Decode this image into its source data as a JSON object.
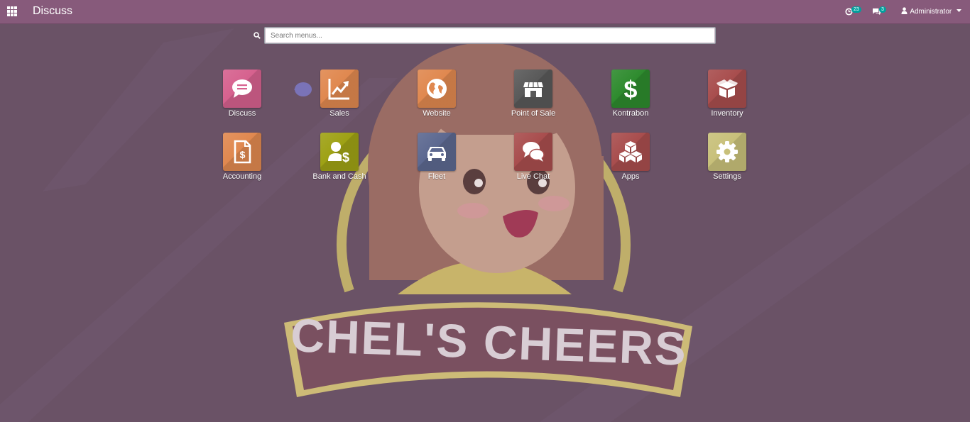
{
  "navbar": {
    "title": "Discuss",
    "activity_count": "23",
    "message_count": "3",
    "user_name": "Administrator"
  },
  "search": {
    "placeholder": "Search menus..."
  },
  "background": {
    "logo_text": "CHEL'S CHEERS"
  },
  "apps": {
    "discuss": "Discuss",
    "sales": "Sales",
    "website": "Website",
    "point_of_sale": "Point of Sale",
    "kontrabon": "Kontrabon",
    "inventory": "Inventory",
    "accounting": "Accounting",
    "bank_and_cash": "Bank and Cash",
    "fleet": "Fleet",
    "live_chat": "Live Chat",
    "apps": "Apps",
    "settings": "Settings"
  },
  "colors": {
    "navbar": "#875a7b",
    "background": "#6a5266",
    "badge": "#00a09d",
    "discuss": "#d6618e",
    "sales": "#e0884f",
    "website": "#e0884f",
    "point_of_sale": "#595959",
    "kontrabon": "#2e8b2e",
    "inventory": "#a84d4d",
    "accounting": "#e0884f",
    "bank_and_cash": "#9ea114",
    "fleet": "#5c6890",
    "live_chat": "#a84d4d",
    "apps": "#a84d4d",
    "settings": "#c8c07a"
  }
}
